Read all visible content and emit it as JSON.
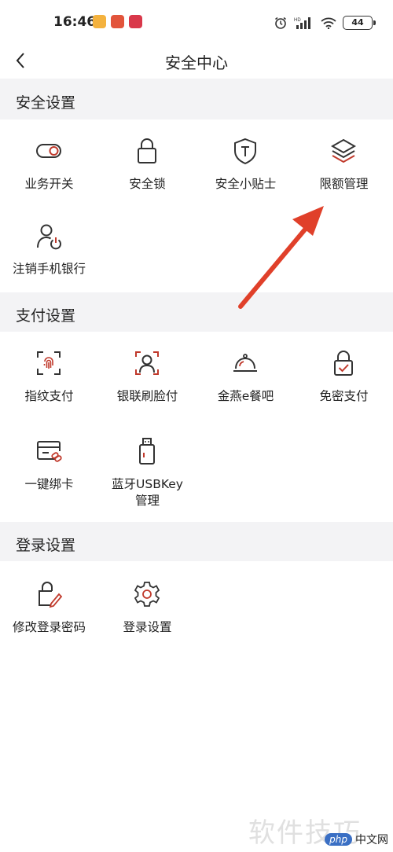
{
  "status_bar": {
    "time": "16:46",
    "battery": "44",
    "network_label": "HD",
    "app_icon_colors": [
      "#f4b23e",
      "#e2543b",
      "#d9384a"
    ]
  },
  "header": {
    "title": "安全中心",
    "back_icon": "chevron-left-icon"
  },
  "sections": [
    {
      "title": "安全设置",
      "items": [
        {
          "label": "业务开关",
          "icon": "toggle-icon"
        },
        {
          "label": "安全锁",
          "icon": "lock-icon"
        },
        {
          "label": "安全小贴士",
          "icon": "shield-icon"
        },
        {
          "label": "限额管理",
          "icon": "layers-icon"
        },
        {
          "label": "注销手机银行",
          "icon": "user-power-icon"
        }
      ]
    },
    {
      "title": "支付设置",
      "items": [
        {
          "label": "指纹支付",
          "icon": "fingerprint-icon"
        },
        {
          "label": "银联刷脸付",
          "icon": "face-scan-icon"
        },
        {
          "label": "金燕e餐吧",
          "icon": "dish-cover-icon"
        },
        {
          "label": "免密支付",
          "icon": "lock-check-icon"
        },
        {
          "label": "一键绑卡",
          "icon": "card-link-icon"
        },
        {
          "label": "蓝牙USBKey管理",
          "icon": "usb-key-icon"
        }
      ]
    },
    {
      "title": "登录设置",
      "items": [
        {
          "label": "修改登录密码",
          "icon": "edit-lock-icon"
        },
        {
          "label": "登录设置",
          "icon": "gear-icon"
        }
      ]
    }
  ],
  "colors": {
    "accent": "#c0392b",
    "icon_stroke": "#333333",
    "section_bg": "#f3f3f5",
    "arrow": "#e0402a"
  },
  "watermark": {
    "text": "软件技巧",
    "logo_php": "php",
    "logo_site": "中文网"
  }
}
